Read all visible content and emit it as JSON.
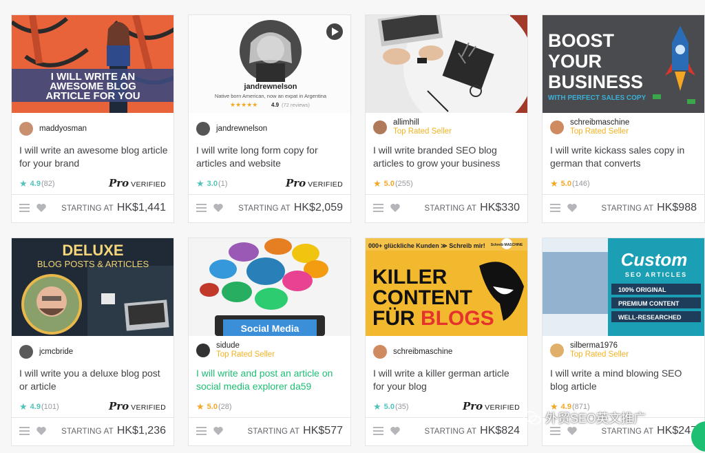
{
  "gigs": [
    {
      "seller": "maddyosman",
      "badge": "",
      "title": "I will write an awesome blog article for your brand",
      "title_green": false,
      "rating": "4.9",
      "count": "(82)",
      "pro": true,
      "price": "HK$1,441",
      "thumb_text": [
        "I WILL WRITE AN",
        "AWESOME BLOG",
        "ARTICLE FOR YOU"
      ]
    },
    {
      "seller": "jandrewnelson",
      "badge": "",
      "title": "I will write long form copy for articles and website",
      "title_green": false,
      "rating": "3.0",
      "count": "(1)",
      "pro": true,
      "price": "HK$2,059",
      "thumb_text": [
        "jandrewnelson",
        "Native born American, now an expat in Argentina",
        "4.9",
        "(72 reviews)"
      ]
    },
    {
      "seller": "allimhill",
      "badge": "Top Rated Seller",
      "title": "I will write branded SEO blog articles to grow your business",
      "title_green": false,
      "rating": "5.0",
      "count": "(255)",
      "pro": false,
      "price": "HK$330",
      "thumb_text": []
    },
    {
      "seller": "schreibmaschine",
      "badge": "Top Rated Seller",
      "title": "I will write kickass sales copy in german that converts",
      "title_green": false,
      "rating": "5.0",
      "count": "(146)",
      "pro": false,
      "price": "HK$988",
      "thumb_text": [
        "BOOST",
        "YOUR",
        "BUSINESS",
        "WITH PERFECT SALES COPY"
      ]
    },
    {
      "seller": "jcmcbride",
      "badge": "",
      "title": "I will write you a deluxe blog post or article",
      "title_green": false,
      "rating": "4.9",
      "count": "(101)",
      "pro": true,
      "price": "HK$1,236",
      "thumb_text": [
        "DELUXE",
        "BLOG POSTS & ARTICLES"
      ]
    },
    {
      "seller": "sidude",
      "badge": "Top Rated Seller",
      "title": "I will write and post an article on social media explorer da59",
      "title_green": true,
      "rating": "5.0",
      "count": "(28)",
      "pro": false,
      "price": "HK$577",
      "thumb_text": [
        "Social Media"
      ]
    },
    {
      "seller": "schreibmaschine",
      "badge": "",
      "title": "I will write a killer german article for your blog",
      "title_green": false,
      "rating": "5.0",
      "count": "(35)",
      "pro": true,
      "price": "HK$824",
      "thumb_text": [
        "000+ glückliche Kunden ≫ Schreib mir!",
        "KILLER",
        "CONTENT",
        "FÜR",
        "BLOGS",
        "Schreib MASCHINE"
      ]
    },
    {
      "seller": "silberma1976",
      "badge": "Top Rated Seller",
      "title": "I will write a mind blowing SEO blog article",
      "title_green": false,
      "rating": "4.9",
      "count": "(871)",
      "pro": false,
      "price": "HK$247",
      "thumb_text": [
        "Custom",
        "SEO ARTICLES",
        "100% ORIGINAL",
        "PREMIUM CONTENT",
        "WELL-RESEARCHED"
      ]
    }
  ],
  "ui": {
    "starting_at": "STARTING AT",
    "pro_mark": "Pro",
    "verified": "VERIFIED",
    "star": "★"
  },
  "watermark": "外贸SEO英文推广",
  "colors": {
    "green": "#1dbf73",
    "gold": "#f5b120",
    "teal_star": "#4fc3b9",
    "orange_star": "#f5a623"
  }
}
